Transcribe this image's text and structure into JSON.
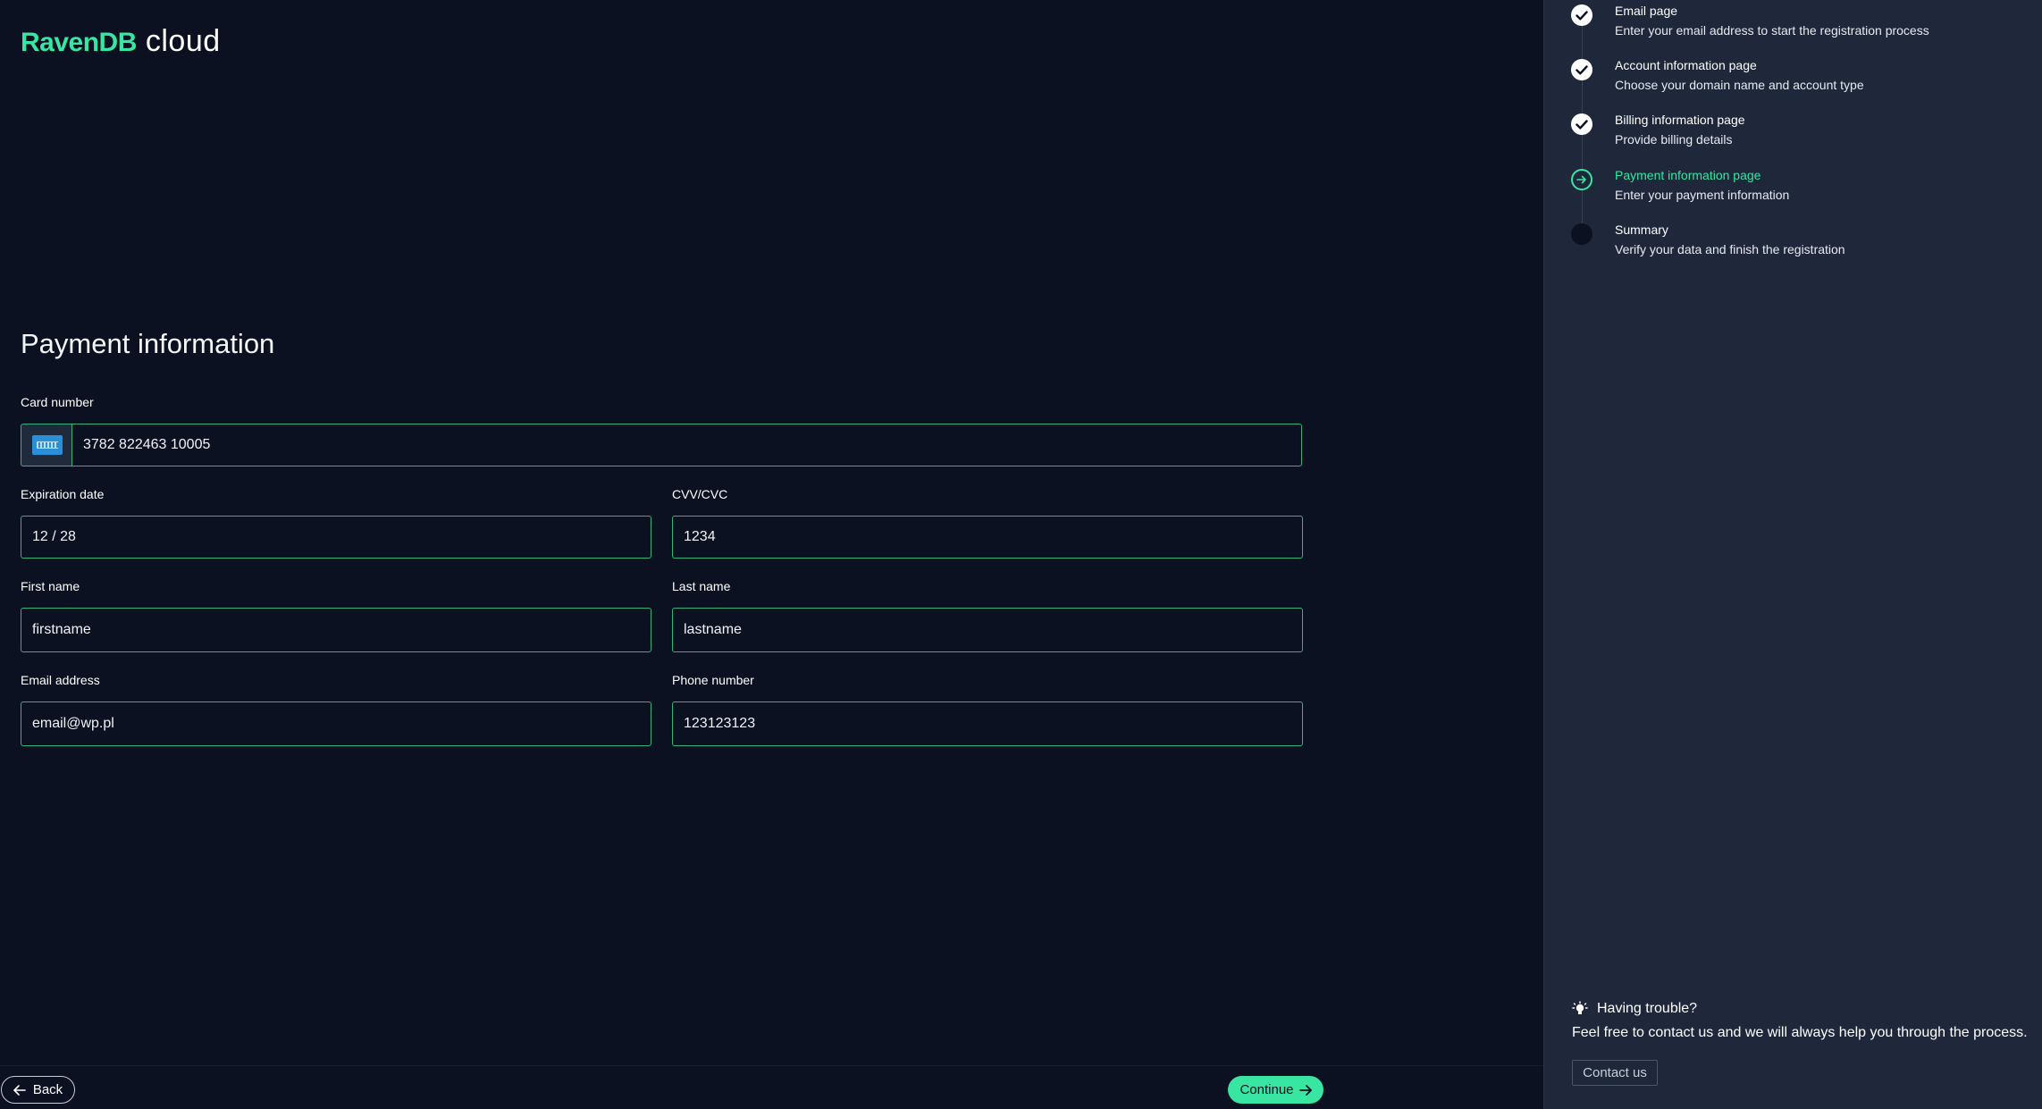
{
  "logo": {
    "brand": "RavenDB",
    "product": "cloud"
  },
  "page": {
    "title": "Payment information"
  },
  "form": {
    "card_number": {
      "label": "Card number",
      "value": "3782 822463 10005",
      "card_icon": "amex-card-icon"
    },
    "expiration_date": {
      "label": "Expiration date",
      "value": "12 / 28"
    },
    "cvv": {
      "label": "CVV/CVC",
      "value": "1234"
    },
    "first_name": {
      "label": "First name",
      "value": "firstname"
    },
    "last_name": {
      "label": "Last name",
      "value": "lastname"
    },
    "email": {
      "label": "Email address",
      "value": "email@wp.pl"
    },
    "phone": {
      "label": "Phone number",
      "value": "123123123"
    }
  },
  "footer": {
    "back_label": "Back",
    "continue_label": "Continue"
  },
  "steps": [
    {
      "title": "Email page",
      "description": "Enter your email address to start the registration process",
      "status": "done"
    },
    {
      "title": "Account information page",
      "description": "Choose your domain name and account type",
      "status": "done"
    },
    {
      "title": "Billing information page",
      "description": "Provide billing details",
      "status": "done"
    },
    {
      "title": "Payment information page",
      "description": "Enter your payment information",
      "status": "current"
    },
    {
      "title": "Summary",
      "description": "Verify your data and finish the registration",
      "status": "pending"
    }
  ],
  "help": {
    "title": "Having trouble?",
    "text": "Feel free to contact us and we will always help you through the process.",
    "contact_label": "Contact us"
  },
  "colors": {
    "background": "#0b1120",
    "sidebar": "#1f283b",
    "accent": "#38e5a1",
    "field_border": "#35b27c"
  }
}
